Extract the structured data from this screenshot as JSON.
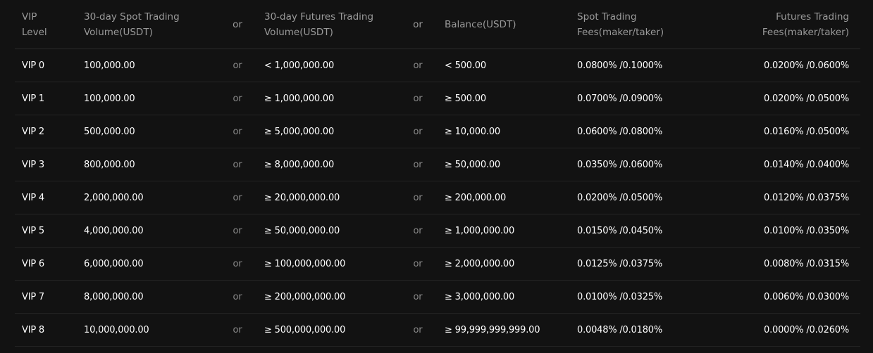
{
  "table": {
    "headers": {
      "vip_level": [
        "VIP",
        "Level"
      ],
      "spot_volume": [
        "30-day Spot Trading",
        "Volume(USDT)"
      ],
      "or_1": "or",
      "futures_volume": [
        "30-day Futures Trading",
        "Volume(USDT)"
      ],
      "or_2": "or",
      "balance": [
        "Balance(USDT)"
      ],
      "spot_fees": [
        "Spot Trading",
        "Fees(maker/taker)"
      ],
      "futures_fees": [
        "Futures Trading",
        "Fees(maker/taker)"
      ]
    },
    "or_label": "or",
    "rows": [
      {
        "level": "VIP 0",
        "spot_volume": "100,000.00",
        "futures_volume": "< 1,000,000.00",
        "balance": "< 500.00",
        "spot_fees": "0.0800% /0.1000%",
        "futures_fees": "0.0200% /0.0600%"
      },
      {
        "level": "VIP 1",
        "spot_volume": "100,000.00",
        "futures_volume": "≥ 1,000,000.00",
        "balance": "≥ 500.00",
        "spot_fees": "0.0700% /0.0900%",
        "futures_fees": "0.0200% /0.0500%"
      },
      {
        "level": "VIP 2",
        "spot_volume": "500,000.00",
        "futures_volume": "≥ 5,000,000.00",
        "balance": "≥ 10,000.00",
        "spot_fees": "0.0600% /0.0800%",
        "futures_fees": "0.0160% /0.0500%"
      },
      {
        "level": "VIP 3",
        "spot_volume": "800,000.00",
        "futures_volume": "≥ 8,000,000.00",
        "balance": "≥ 50,000.00",
        "spot_fees": "0.0350% /0.0600%",
        "futures_fees": "0.0140% /0.0400%"
      },
      {
        "level": "VIP 4",
        "spot_volume": "2,000,000.00",
        "futures_volume": "≥ 20,000,000.00",
        "balance": "≥ 200,000.00",
        "spot_fees": "0.0200% /0.0500%",
        "futures_fees": "0.0120% /0.0375%"
      },
      {
        "level": "VIP 5",
        "spot_volume": "4,000,000.00",
        "futures_volume": "≥ 50,000,000.00",
        "balance": "≥ 1,000,000.00",
        "spot_fees": "0.0150% /0.0450%",
        "futures_fees": "0.0100% /0.0350%"
      },
      {
        "level": "VIP 6",
        "spot_volume": "6,000,000.00",
        "futures_volume": "≥ 100,000,000.00",
        "balance": "≥ 2,000,000.00",
        "spot_fees": "0.0125% /0.0375%",
        "futures_fees": "0.0080% /0.0315%"
      },
      {
        "level": "VIP 7",
        "spot_volume": "8,000,000.00",
        "futures_volume": "≥ 200,000,000.00",
        "balance": "≥ 3,000,000.00",
        "spot_fees": "0.0100% /0.0325%",
        "futures_fees": "0.0060% /0.0300%"
      },
      {
        "level": "VIP 8",
        "spot_volume": "10,000,000.00",
        "futures_volume": "≥ 500,000,000.00",
        "balance": "≥ 99,999,999,999.00",
        "spot_fees": "0.0048% /0.0180%",
        "futures_fees": "0.0000% /0.0260%"
      }
    ]
  }
}
